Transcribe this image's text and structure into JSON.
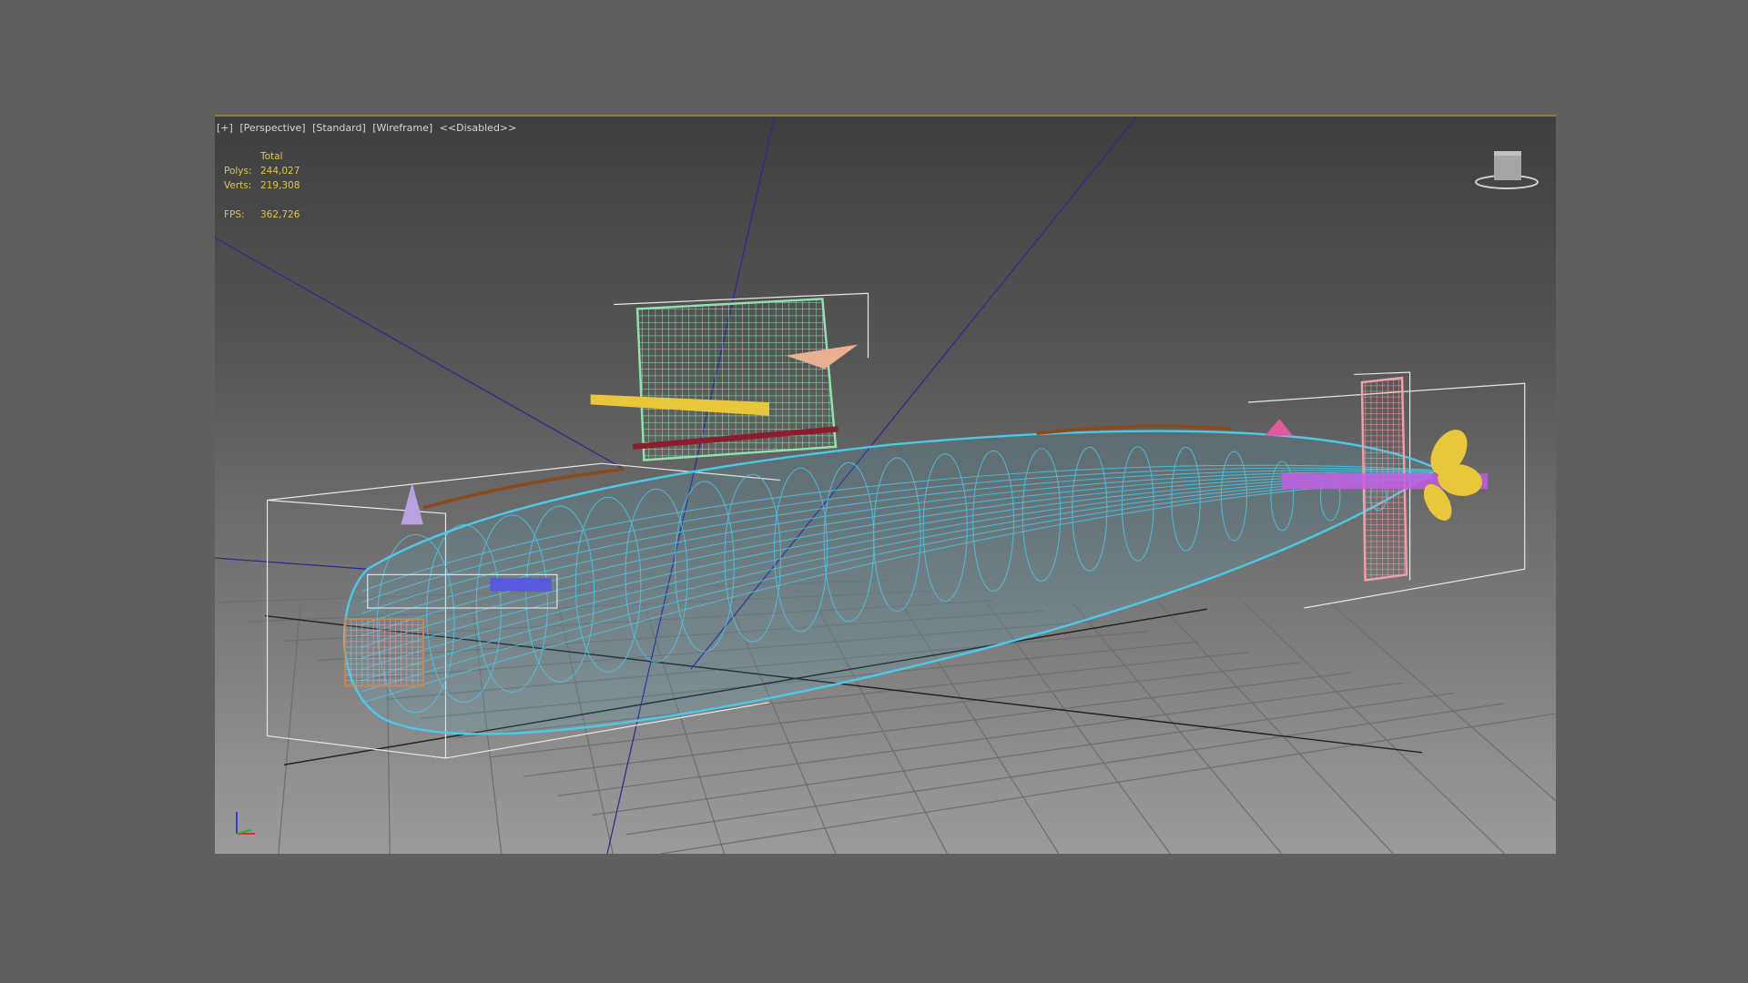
{
  "viewport": {
    "labels": {
      "plus": "[+]",
      "view": "[Perspective]",
      "shading": "[Standard]",
      "mode": "[Wireframe]",
      "status": "<<Disabled>>"
    },
    "stats": {
      "header": "Total",
      "polys_label": "Polys:",
      "polys": "244,027",
      "verts_label": "Verts:",
      "verts": "219,308",
      "fps_label": "FPS:",
      "fps": "362,726"
    },
    "viewcube_icon": "viewcube-icon",
    "axis_icon": "axis-tripod-icon"
  },
  "colors": {
    "hull": "#4cc8e8",
    "sail": "#8fe3b0",
    "rudder": "#f0a0a8",
    "propeller": "#e8c83a",
    "shaft": "#c35ce0",
    "stats": "#d8c64a"
  }
}
